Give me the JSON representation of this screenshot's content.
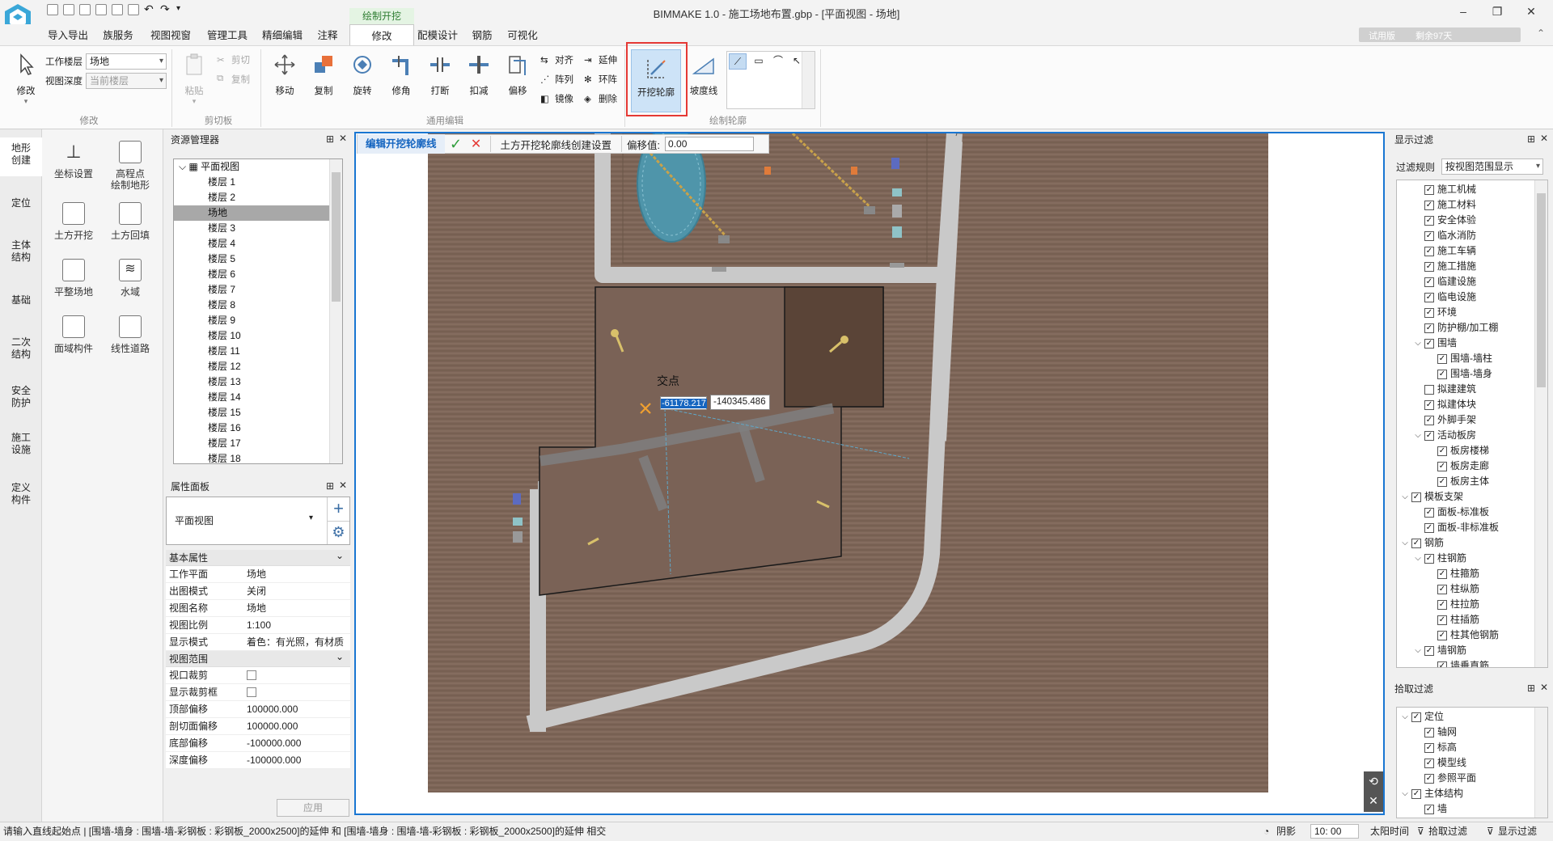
{
  "app": {
    "title": "BIMMAKE 1.0 - 施工场地布置.gbp - [平面视图 - 场地]"
  },
  "tabs": [
    "导入导出",
    "族服务",
    "视图视窗",
    "管理工具",
    "精细编辑",
    "注释",
    "修改",
    "配模设计",
    "钢筋",
    "可视化"
  ],
  "context_group": "绘制开挖",
  "trial": {
    "label": "试用版",
    "remaining": "剩余97天"
  },
  "ribbon": {
    "modify": {
      "label": "修改",
      "group": "修改",
      "work_level_label": "工作楼层",
      "work_level_value": "场地",
      "view_depth_label": "视图深度",
      "view_depth_value": "当前楼层"
    },
    "clipboard": {
      "paste": "粘贴",
      "cut": "剪切",
      "copy": "复制",
      "group": "剪切板"
    },
    "edit": {
      "group": "通用编辑",
      "move": "移动",
      "copy": "复制",
      "rotate": "旋转",
      "fillet": "修角",
      "break": "打断",
      "deduct": "扣减",
      "offset": "偏移",
      "align": "对齐",
      "extend": "延伸",
      "array": "阵列",
      "ring_array": "环阵",
      "mirror": "镜像",
      "delete": "删除"
    },
    "contour": {
      "group": "绘制轮廓",
      "excavation": "开挖轮廓",
      "slope": "坡度线"
    }
  },
  "categories": [
    "地形\n创建",
    "定位",
    "主体\n结构",
    "基础",
    "二次\n结构",
    "安全\n防护",
    "施工\n设施",
    "定义\n构件"
  ],
  "tools": [
    "坐标设置",
    "高程点\n绘制地形",
    "土方开挖",
    "土方回填",
    "平整场地",
    "水域",
    "面域构件",
    "线性道路"
  ],
  "resource_manager": {
    "title": "资源管理器",
    "root": "平面视图",
    "items": [
      "楼层 1",
      "楼层 2",
      "场地",
      "楼层 3",
      "楼层 4",
      "楼层 5",
      "楼层 6",
      "楼层 7",
      "楼层 8",
      "楼层 9",
      "楼层 10",
      "楼层 11",
      "楼层 12",
      "楼层 13",
      "楼层 14",
      "楼层 15",
      "楼层 16",
      "楼层 17",
      "楼层 18"
    ],
    "selected": "场地"
  },
  "properties": {
    "title": "属性面板",
    "type": "平面视图",
    "basic_section": "基本属性",
    "rows": [
      {
        "k": "工作平面",
        "v": "场地"
      },
      {
        "k": "出图模式",
        "v": "关闭"
      },
      {
        "k": "视图名称",
        "v": "场地"
      },
      {
        "k": "视图比例",
        "v": "1:100"
      },
      {
        "k": "显示模式",
        "v": "着色：有光照，有材质"
      }
    ],
    "range_section": "视图范围",
    "range_rows": [
      {
        "k": "视口裁剪",
        "v": ""
      },
      {
        "k": "显示裁剪框",
        "v": ""
      },
      {
        "k": "顶部偏移",
        "v": "100000.000"
      },
      {
        "k": "剖切面偏移",
        "v": "100000.000"
      },
      {
        "k": "底部偏移",
        "v": "-100000.000"
      },
      {
        "k": "深度偏移",
        "v": "-100000.000"
      }
    ],
    "apply": "应用"
  },
  "editbar": {
    "title": "编辑开挖轮廓线",
    "settings": "土方开挖轮廓线创建设置",
    "offset_label": "偏移值:",
    "offset_value": "0.00"
  },
  "canvas": {
    "snap_label": "交点",
    "coord_x": "-61178.217",
    "coord_y": "-140345.486"
  },
  "display_filter": {
    "title": "显示过滤",
    "rule_label": "过滤规则",
    "rule_value": "按视图范围显示",
    "items": [
      {
        "t": "施工机械",
        "l": 1
      },
      {
        "t": "施工材料",
        "l": 1
      },
      {
        "t": "安全体验",
        "l": 1
      },
      {
        "t": "临水消防",
        "l": 1
      },
      {
        "t": "施工车辆",
        "l": 1
      },
      {
        "t": "施工措施",
        "l": 1
      },
      {
        "t": "临建设施",
        "l": 1
      },
      {
        "t": "临电设施",
        "l": 1
      },
      {
        "t": "环境",
        "l": 1
      },
      {
        "t": "防护棚/加工棚",
        "l": 1
      },
      {
        "t": "围墙",
        "l": 1,
        "e": 1
      },
      {
        "t": "围墙-墙柱",
        "l": 2
      },
      {
        "t": "围墙-墙身",
        "l": 2
      },
      {
        "t": "拟建建筑",
        "l": 1,
        "u": 1
      },
      {
        "t": "拟建体块",
        "l": 1
      },
      {
        "t": "外脚手架",
        "l": 1
      },
      {
        "t": "活动板房",
        "l": 1,
        "e": 1
      },
      {
        "t": "板房楼梯",
        "l": 2
      },
      {
        "t": "板房走廊",
        "l": 2
      },
      {
        "t": "板房主体",
        "l": 2
      },
      {
        "t": "模板支架",
        "l": 0,
        "e": 1
      },
      {
        "t": "面板-标准板",
        "l": 1
      },
      {
        "t": "面板-非标准板",
        "l": 1
      },
      {
        "t": "钢筋",
        "l": 0,
        "e": 1
      },
      {
        "t": "柱钢筋",
        "l": 1,
        "e": 1
      },
      {
        "t": "柱箍筋",
        "l": 2
      },
      {
        "t": "柱纵筋",
        "l": 2
      },
      {
        "t": "柱拉筋",
        "l": 2
      },
      {
        "t": "柱插筋",
        "l": 2
      },
      {
        "t": "柱其他钢筋",
        "l": 2
      },
      {
        "t": "墙钢筋",
        "l": 1,
        "e": 1
      },
      {
        "t": "墙垂直筋",
        "l": 2
      }
    ]
  },
  "pick_filter": {
    "title": "拾取过滤",
    "items": [
      {
        "t": "定位",
        "l": 0,
        "e": 1
      },
      {
        "t": "轴网",
        "l": 1
      },
      {
        "t": "标高",
        "l": 1
      },
      {
        "t": "模型线",
        "l": 1
      },
      {
        "t": "参照平面",
        "l": 1
      },
      {
        "t": "主体结构",
        "l": 0,
        "e": 1
      },
      {
        "t": "墙",
        "l": 1
      }
    ]
  },
  "status": {
    "message": "请输入直线起始点 | [围墙-墙身 : 围墙-墙-彩钢板 : 彩钢板_2000x2500]的延伸 和 [围墙-墙身 : 围墙-墙-彩钢板 : 彩钢板_2000x2500]的延伸 相交",
    "shadow": "阴影",
    "time": "10: 00",
    "sun": "太阳时间",
    "pick": "拾取过滤",
    "display": "显示过滤"
  },
  "colors": {
    "accent": "#1976d2",
    "highlight": "#e53935",
    "soil": "#7d6558",
    "road": "#c9c9c9",
    "water": "#4f95aa"
  }
}
